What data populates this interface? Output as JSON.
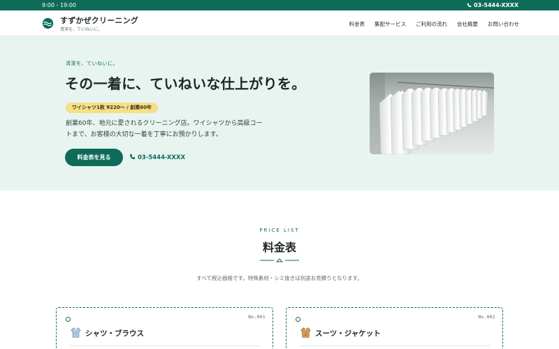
{
  "topbar": {
    "hours": "9:00 - 19:00",
    "phone": "03-5444-XXXX"
  },
  "header": {
    "brand_name": "すずかぜクリーニング",
    "brand_tagline": "清潔を、ていねいに。",
    "nav": [
      "料金表",
      "集配サービス",
      "ご利用の流れ",
      "会社概要",
      "お問い合わせ"
    ]
  },
  "hero": {
    "eyebrow": "清潔を、ていねいに。",
    "headline": "その一着に、ていねいな仕上がりを。",
    "badge": "ワイシャツ1枚 ¥220〜 / 創業60年",
    "description": "創業60年、地元に愛されるクリーニング店。ワイシャツから高級コートまで、お客様の大切な一着を丁寧にお預かりします。",
    "cta_label": "料金表を見る",
    "phone": "03-5444-XXXX"
  },
  "price_section": {
    "eyebrow": "PRICE LIST",
    "title": "料金表",
    "note": "すべて税込価格です。特殊素材・シミ抜きは別途お見積りとなります。",
    "cards": [
      {
        "number": "No.001",
        "title": "シャツ・ブラウス",
        "icon": "shirt-icon"
      },
      {
        "number": "No.002",
        "title": "スーツ・ジャケット",
        "icon": "suit-jacket-icon"
      }
    ]
  },
  "colors": {
    "brand_green": "#0e6b5a",
    "hero_bg": "#e8f4f0",
    "badge_yellow": "#f6df86"
  }
}
